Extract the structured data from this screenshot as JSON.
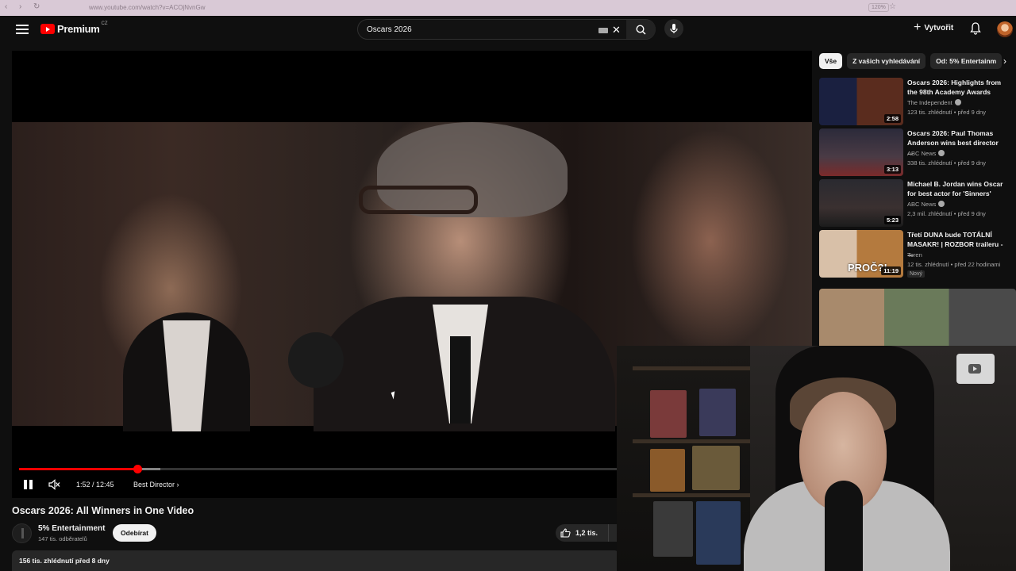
{
  "browser": {
    "url": "www.youtube.com/watch?v=ACOjNvnGw",
    "zoom": "120%"
  },
  "masthead": {
    "logo_word": "Premium",
    "logo_region": "CZ",
    "search_value": "Oscars 2026",
    "create_label": "Vytvořit"
  },
  "player": {
    "time": "1:52 / 12:45",
    "chapter": "Best Director",
    "progress_played_pct": 15,
    "progress_loaded_pct": 18
  },
  "video": {
    "title": "Oscars 2026: All Winners in One Video",
    "channel": "5% Entertainment",
    "subscribers": "147 tis. odběratelů",
    "subscribe_label": "Odebírat",
    "likes": "1,2 tis.",
    "views_date": "156 tis. zhlédnutí  před 8 dny"
  },
  "chips": [
    "Vše",
    "Z vašich vyhledávání",
    "Od: 5% Entertainm"
  ],
  "recommendations": [
    {
      "title": "Oscars 2026: Highlights from the 98th Academy Awards",
      "channel": "The Independent",
      "verified": true,
      "meta": "123 tis. zhlédnutí • před 9 dny",
      "duration": "2:58",
      "badge": ""
    },
    {
      "title": "Oscars 2026: Paul Thomas Anderson wins best director ...",
      "channel": "ABC News",
      "verified": true,
      "meta": "338 tis. zhlédnutí • před 9 dny",
      "duration": "3:13",
      "badge": ""
    },
    {
      "title": "Michael B. Jordan wins Oscar for best actor for 'Sinners'",
      "channel": "ABC News",
      "verified": true,
      "meta": "2,3 mil. zhlédnutí • před 9 dny",
      "duration": "5:23",
      "badge": ""
    },
    {
      "title": "Třetí DUNA bude TOTÁLNÍ MASAKR! | ROZBOR traileru - ...",
      "channel": "Toren",
      "verified": false,
      "meta": "12 tis. zhlédnutí • před 22 hodinami",
      "duration": "11:19",
      "badge": "Nový",
      "thumb_text": "PROČ?!"
    }
  ],
  "colors": {
    "accent_red": "#ff0000",
    "background": "#0f0f0f",
    "chip_bg": "#272727"
  }
}
